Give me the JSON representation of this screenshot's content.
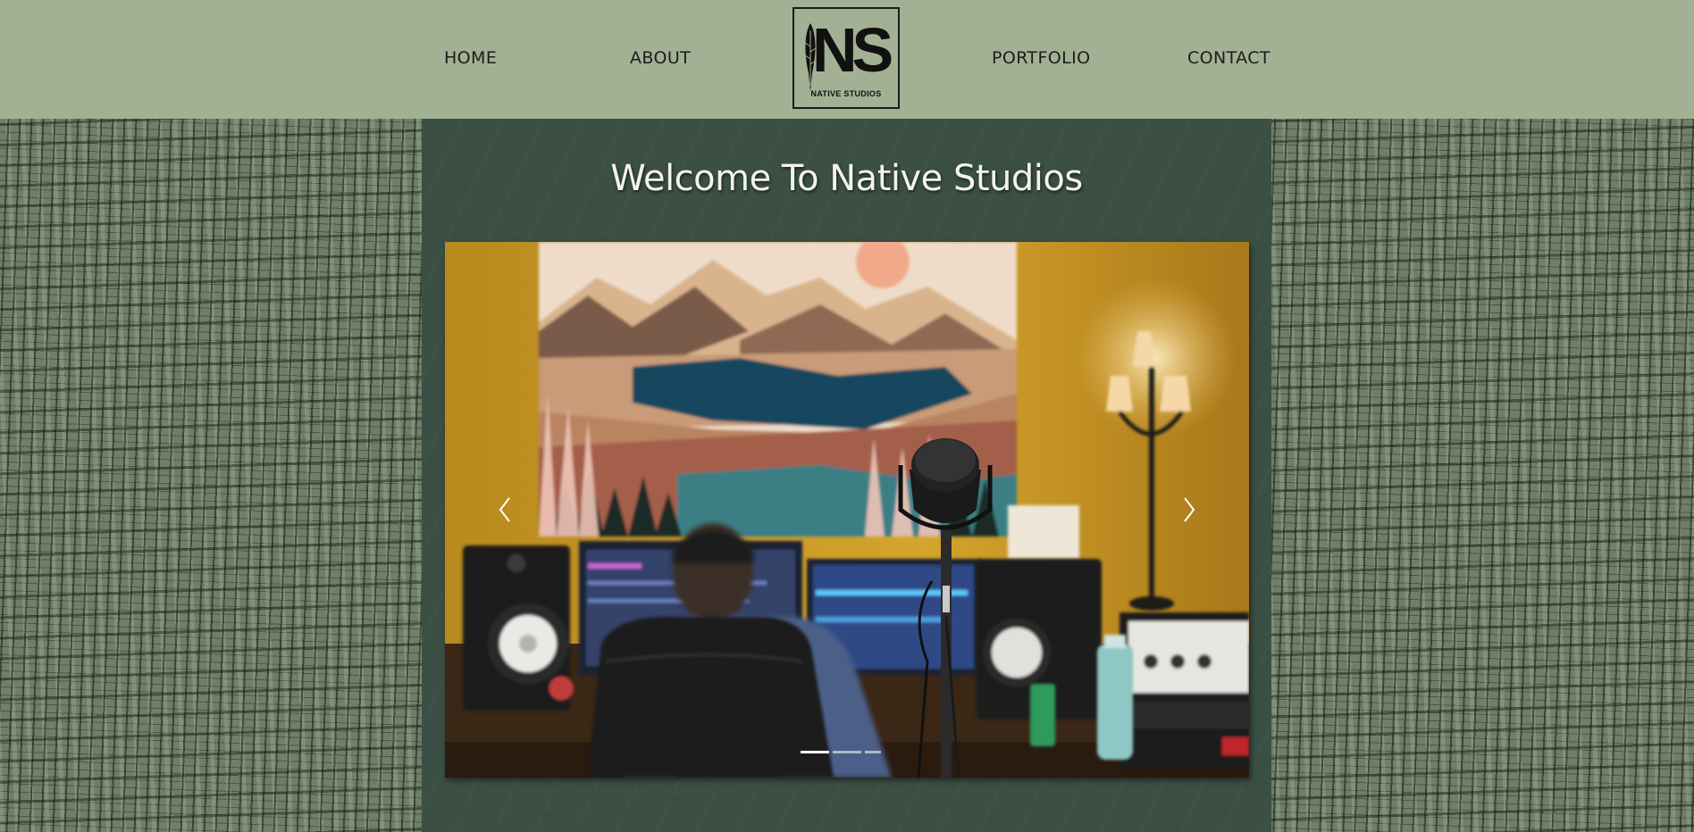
{
  "nav": {
    "home": "HOME",
    "about": "ABOUT",
    "portfolio": "PORTFOLIO",
    "contact": "CONTACT"
  },
  "logo": {
    "letters": "NS",
    "subtitle": "NATIVE STUDIOS",
    "icon": "feather-icon"
  },
  "main": {
    "welcome": "Welcome To Native Studios"
  },
  "slideshow": {
    "image": "recording-studio-photo",
    "slide_count": 3,
    "active_slide": 1,
    "prev_icon": "chevron-left-icon",
    "next_icon": "chevron-right-icon"
  },
  "colors": {
    "header_bg": "#a2b193",
    "panel_bg": "#3b4f45",
    "text_dark": "#1c1c1c",
    "text_light": "#f3f3ee"
  }
}
